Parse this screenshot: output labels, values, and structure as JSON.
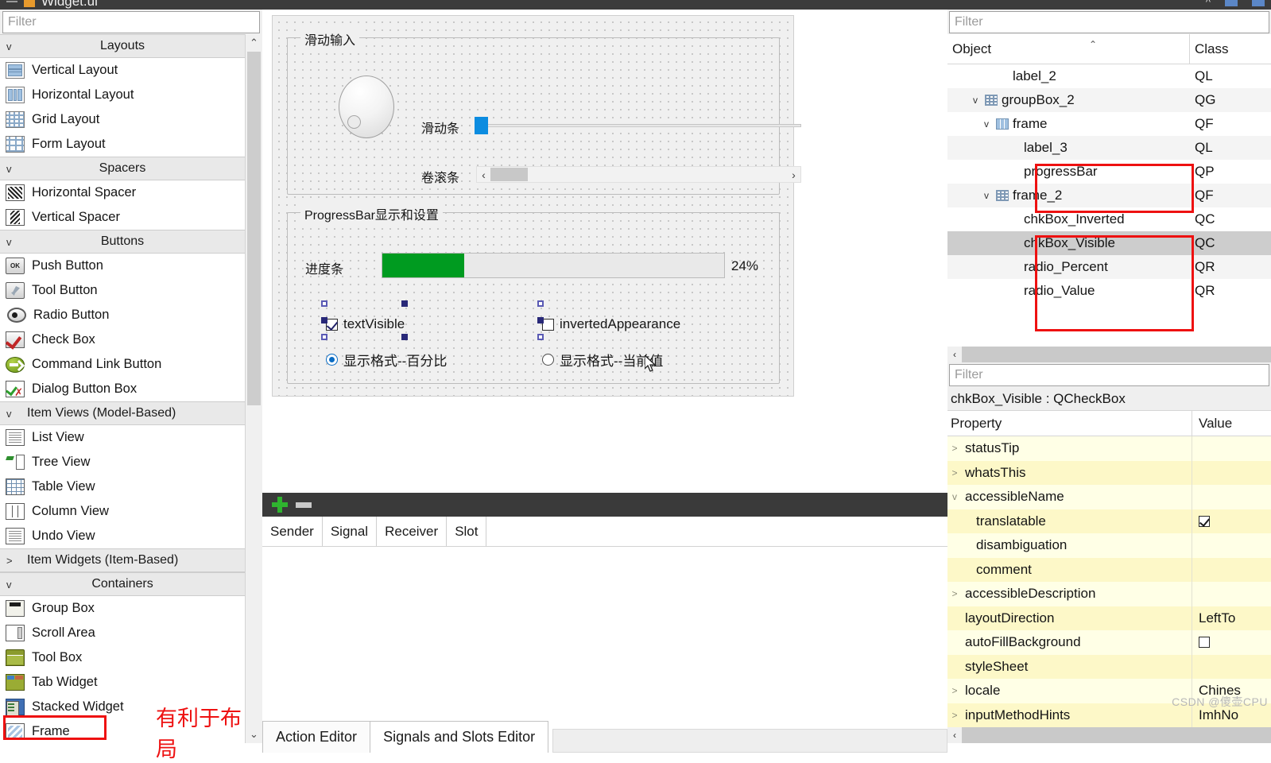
{
  "window": {
    "title": "Widget.ui",
    "icon": "ui-file-icon"
  },
  "widget_box": {
    "filter_placeholder": "Filter",
    "groups": [
      {
        "label": "Layouts",
        "expanded": true,
        "chevron": "v",
        "items": [
          {
            "label": "Vertical Layout",
            "icon": "vertical-layout-icon"
          },
          {
            "label": "Horizontal Layout",
            "icon": "horizontal-layout-icon"
          },
          {
            "label": "Grid Layout",
            "icon": "grid-layout-icon"
          },
          {
            "label": "Form Layout",
            "icon": "form-layout-icon"
          }
        ]
      },
      {
        "label": "Spacers",
        "expanded": true,
        "chevron": "v",
        "items": [
          {
            "label": "Horizontal Spacer",
            "icon": "horizontal-spacer-icon"
          },
          {
            "label": "Vertical Spacer",
            "icon": "vertical-spacer-icon"
          }
        ]
      },
      {
        "label": "Buttons",
        "expanded": true,
        "chevron": "v",
        "items": [
          {
            "label": "Push Button",
            "icon": "push-button-icon"
          },
          {
            "label": "Tool Button",
            "icon": "tool-button-icon"
          },
          {
            "label": "Radio Button",
            "icon": "radio-button-icon"
          },
          {
            "label": "Check Box",
            "icon": "check-box-icon"
          },
          {
            "label": "Command Link Button",
            "icon": "command-link-icon"
          },
          {
            "label": "Dialog Button Box",
            "icon": "dialog-button-box-icon"
          }
        ]
      },
      {
        "label": "Item Views (Model-Based)",
        "expanded": true,
        "chevron": "v",
        "align": "left",
        "items": [
          {
            "label": "List View",
            "icon": "list-view-icon"
          },
          {
            "label": "Tree View",
            "icon": "tree-view-icon"
          },
          {
            "label": "Table View",
            "icon": "table-view-icon"
          },
          {
            "label": "Column View",
            "icon": "column-view-icon"
          },
          {
            "label": "Undo View",
            "icon": "undo-view-icon"
          }
        ]
      },
      {
        "label": "Item Widgets (Item-Based)",
        "expanded": false,
        "chevron": ">",
        "align": "left",
        "items": []
      },
      {
        "label": "Containers",
        "expanded": true,
        "chevron": "v",
        "items": [
          {
            "label": "Group Box",
            "icon": "group-box-icon"
          },
          {
            "label": "Scroll Area",
            "icon": "scroll-area-icon"
          },
          {
            "label": "Tool Box",
            "icon": "tool-box-icon"
          },
          {
            "label": "Tab Widget",
            "icon": "tab-widget-icon"
          },
          {
            "label": "Stacked Widget",
            "icon": "stacked-widget-icon"
          },
          {
            "label": "Frame",
            "icon": "frame-icon",
            "highlighted": true
          }
        ]
      }
    ],
    "annotation": {
      "text": "有利于布局",
      "color": "#ee1111"
    },
    "highlight_color": "#ee1111"
  },
  "form": {
    "group1": {
      "title": "滑动输入",
      "dial_label": "dial",
      "rows": [
        {
          "label": "滑动条",
          "widget": "slider"
        },
        {
          "label": "卷滚条",
          "widget": "scrollbar"
        }
      ],
      "slider": {
        "value": 0,
        "handle_color": "#0c8ce0"
      },
      "scrollbar": {
        "left_arrow": "‹",
        "right_arrow": "›"
      }
    },
    "group2": {
      "title": "ProgressBar显示和设置",
      "progress_label": "进度条",
      "progress_percent": 24,
      "progress_value_text": "24%",
      "progress_fill_color": "#009b20",
      "checkboxes": [
        {
          "label": "textVisible",
          "checked": true,
          "selected": true
        },
        {
          "label": "invertedAppearance",
          "checked": false,
          "selected": true
        }
      ],
      "radios": [
        {
          "label": "显示格式--百分比",
          "checked": true
        },
        {
          "label": "显示格式--当前值",
          "checked": false
        }
      ]
    }
  },
  "signal_slot_editor": {
    "toolbar": {
      "add": "add-row-icon",
      "remove": "remove-row-icon"
    },
    "columns": [
      "Sender",
      "Signal",
      "Receiver",
      "Slot"
    ],
    "rows": [],
    "tabs": [
      {
        "label": "Action Editor",
        "active": false
      },
      {
        "label": "Signals and Slots Editor",
        "active": true
      }
    ]
  },
  "object_inspector": {
    "filter_placeholder": "Filter",
    "columns": [
      "Object",
      "Class"
    ],
    "rows": [
      {
        "indent": 3,
        "name": "label_2",
        "cls": "QL",
        "chevron": "",
        "icon": "",
        "alt": false,
        "selected": false
      },
      {
        "indent": 2,
        "name": "groupBox_2",
        "cls": "QG",
        "chevron": "v",
        "icon": "grid",
        "alt": true,
        "selected": false
      },
      {
        "indent": 3,
        "name": "frame",
        "cls": "QF",
        "chevron": "v",
        "icon": "hl",
        "alt": false,
        "selected": false
      },
      {
        "indent": 4,
        "name": "label_3",
        "cls": "QL",
        "chevron": "",
        "icon": "",
        "alt": true,
        "selected": false
      },
      {
        "indent": 4,
        "name": "progressBar",
        "cls": "QP",
        "chevron": "",
        "icon": "",
        "alt": false,
        "selected": false
      },
      {
        "indent": 3,
        "name": "frame_2",
        "cls": "QF",
        "chevron": "v",
        "icon": "grid",
        "alt": true,
        "selected": false
      },
      {
        "indent": 4,
        "name": "chkBox_Inverted",
        "cls": "QC",
        "chevron": "",
        "icon": "",
        "alt": false,
        "selected": false
      },
      {
        "indent": 4,
        "name": "chkBox_Visible",
        "cls": "QC",
        "chevron": "",
        "icon": "",
        "alt": false,
        "selected": true
      },
      {
        "indent": 4,
        "name": "radio_Percent",
        "cls": "QR",
        "chevron": "",
        "icon": "",
        "alt": true,
        "selected": false
      },
      {
        "indent": 4,
        "name": "radio_Value",
        "cls": "QR",
        "chevron": "",
        "icon": "",
        "alt": false,
        "selected": false
      }
    ],
    "highlight_color": "#ee1111"
  },
  "property_editor": {
    "filter_placeholder": "Filter",
    "object_header": "chkBox_Visible : QCheckBox",
    "columns": [
      "Property",
      "Value"
    ],
    "rows": [
      {
        "name": "statusTip",
        "value": "",
        "chevron": ">",
        "indent": 1,
        "alt": false,
        "checkbox": null
      },
      {
        "name": "whatsThis",
        "value": "",
        "chevron": ">",
        "indent": 1,
        "alt": true,
        "checkbox": null
      },
      {
        "name": "accessibleName",
        "value": "",
        "chevron": "v",
        "indent": 1,
        "alt": false,
        "checkbox": null
      },
      {
        "name": "translatable",
        "value": "",
        "chevron": "",
        "indent": 2,
        "alt": true,
        "checkbox": true
      },
      {
        "name": "disambiguation",
        "value": "",
        "chevron": "",
        "indent": 2,
        "alt": false,
        "checkbox": null
      },
      {
        "name": "comment",
        "value": "",
        "chevron": "",
        "indent": 2,
        "alt": true,
        "checkbox": null
      },
      {
        "name": "accessibleDescription",
        "value": "",
        "chevron": ">",
        "indent": 1,
        "alt": false,
        "checkbox": null
      },
      {
        "name": "layoutDirection",
        "value": "LeftTo",
        "chevron": "",
        "indent": 1,
        "alt": true,
        "checkbox": null
      },
      {
        "name": "autoFillBackground",
        "value": "",
        "chevron": "",
        "indent": 1,
        "alt": false,
        "checkbox": false
      },
      {
        "name": "styleSheet",
        "value": "",
        "chevron": "",
        "indent": 1,
        "alt": true,
        "checkbox": null
      },
      {
        "name": "locale",
        "value": "Chines",
        "chevron": ">",
        "indent": 1,
        "alt": false,
        "checkbox": null
      },
      {
        "name": "inputMethodHints",
        "value": "ImhNo",
        "chevron": ">",
        "indent": 1,
        "alt": true,
        "checkbox": null
      }
    ]
  },
  "watermark": "CSDN @傻壶CPU"
}
